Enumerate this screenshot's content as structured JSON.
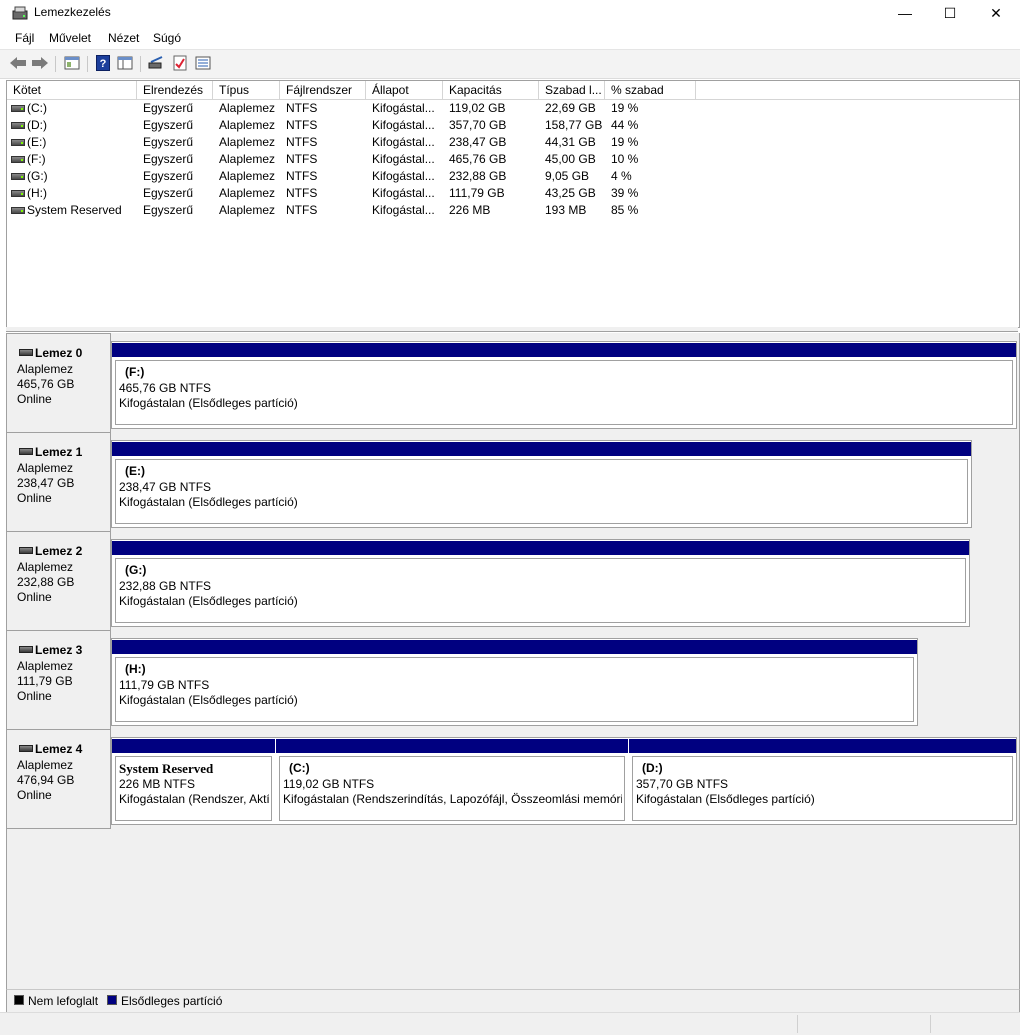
{
  "window": {
    "title": "Lemezkezelés",
    "minimize": "—",
    "maximize": "☐",
    "close": "✕"
  },
  "menu": [
    "Fájl",
    "Művelet",
    "Nézet",
    "Súgó"
  ],
  "toolbar": [
    "back-icon",
    "forward-icon",
    "properties-icon",
    "help-icon",
    "console-tree-icon",
    "connect-icon",
    "check-icon",
    "list-view-icon"
  ],
  "columns": [
    "Kötet",
    "Elrendezés",
    "Típus",
    "Fájlrendszer",
    "Állapot",
    "Kapacitás",
    "Szabad l...",
    "% szabad"
  ],
  "volumes": [
    [
      "(C:)",
      "Egyszerű",
      "Alaplemez",
      "NTFS",
      "Kifogástal...",
      "119,02 GB",
      "22,69 GB",
      "19 %"
    ],
    [
      "(D:)",
      "Egyszerű",
      "Alaplemez",
      "NTFS",
      "Kifogástal...",
      "357,70 GB",
      "158,77 GB",
      "44 %"
    ],
    [
      "(E:)",
      "Egyszerű",
      "Alaplemez",
      "NTFS",
      "Kifogástal...",
      "238,47 GB",
      "44,31 GB",
      "19 %"
    ],
    [
      "(F:)",
      "Egyszerű",
      "Alaplemez",
      "NTFS",
      "Kifogástal...",
      "465,76 GB",
      "45,00 GB",
      "10 %"
    ],
    [
      "(G:)",
      "Egyszerű",
      "Alaplemez",
      "NTFS",
      "Kifogástal...",
      "232,88 GB",
      "9,05 GB",
      "4 %"
    ],
    [
      "(H:)",
      "Egyszerű",
      "Alaplemez",
      "NTFS",
      "Kifogástal...",
      "111,79 GB",
      "43,25 GB",
      "39 %"
    ],
    [
      "System Reserved",
      "Egyszerű",
      "Alaplemez",
      "NTFS",
      "Kifogástal...",
      "226 MB",
      "193 MB",
      "85 %"
    ]
  ],
  "disks": [
    {
      "name": "Lemez 0",
      "type": "Alaplemez",
      "size": "465,76 GB",
      "status": "Online",
      "partitions": [
        {
          "name": "(F:)",
          "size": "465,76 GB NTFS",
          "status": "Kifogástalan (Elsődleges partíció)"
        }
      ]
    },
    {
      "name": "Lemez 1",
      "type": "Alaplemez",
      "size": "238,47 GB",
      "status": "Online",
      "partitions": [
        {
          "name": "(E:)",
          "size": "238,47 GB NTFS",
          "status": "Kifogástalan (Elsődleges partíció)"
        }
      ]
    },
    {
      "name": "Lemez 2",
      "type": "Alaplemez",
      "size": "232,88 GB",
      "status": "Online",
      "partitions": [
        {
          "name": "(G:)",
          "size": "232,88 GB NTFS",
          "status": "Kifogástalan (Elsődleges partíció)"
        }
      ]
    },
    {
      "name": "Lemez 3",
      "type": "Alaplemez",
      "size": "111,79 GB",
      "status": "Online",
      "partitions": [
        {
          "name": "(H:)",
          "size": "111,79 GB NTFS",
          "status": "Kifogástalan (Elsődleges partíció)"
        }
      ]
    },
    {
      "name": "Lemez 4",
      "type": "Alaplemez",
      "size": "476,94 GB",
      "status": "Online",
      "partitions": [
        {
          "name": "System Reserved",
          "size": "226 MB NTFS",
          "status": "Kifogástalan (Rendszer, Aktí"
        },
        {
          "name": "(C:)",
          "size": "119,02 GB NTFS",
          "status": "Kifogástalan (Rendszerindítás, Lapozófájl, Összeomlási memória"
        },
        {
          "name": "(D:)",
          "size": "357,70 GB NTFS",
          "status": "Kifogástalan (Elsődleges partíció)"
        }
      ]
    }
  ],
  "legend": [
    {
      "label": "Nem lefoglalt",
      "color": "#000000"
    },
    {
      "label": "Elsődleges partíció",
      "color": "#000080"
    }
  ]
}
